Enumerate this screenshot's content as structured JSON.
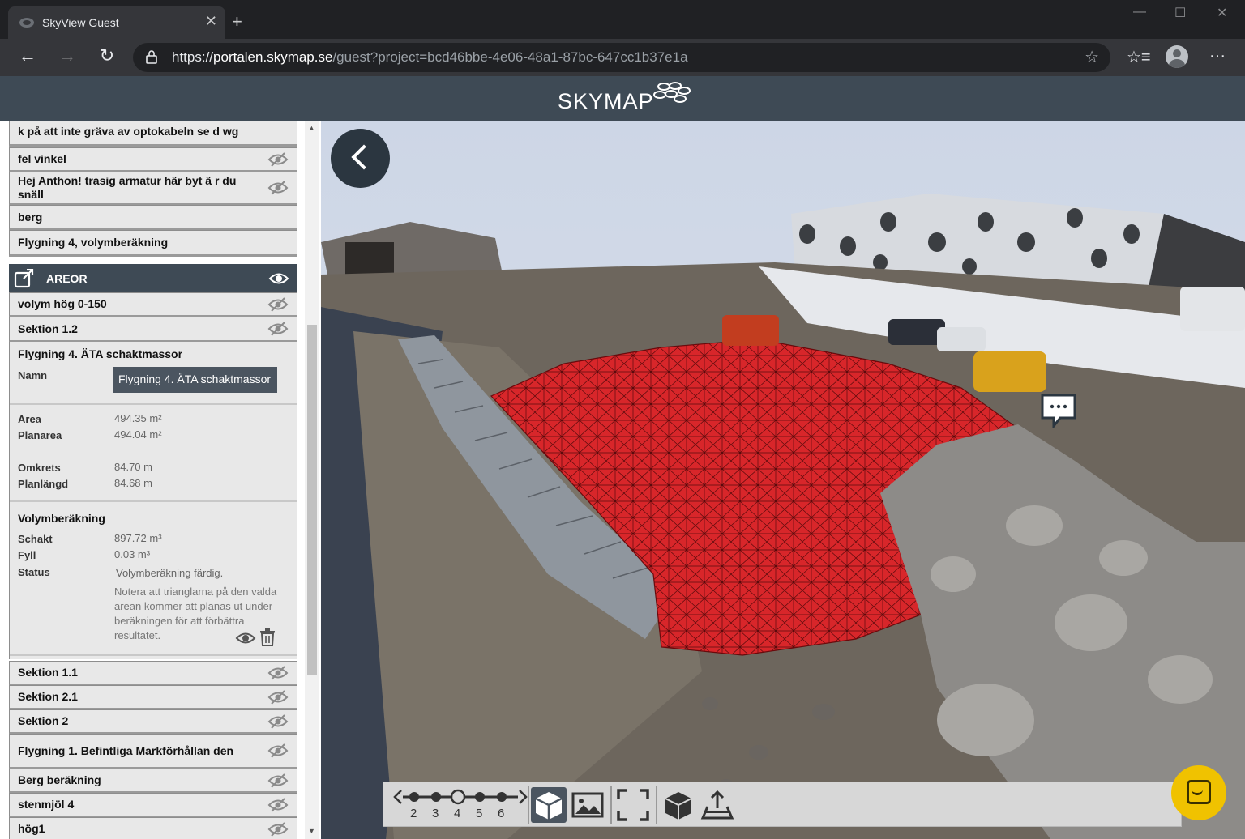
{
  "browser": {
    "tab_title": "SkyView Guest",
    "tab_close": "✕",
    "new_tab": "+",
    "url_scheme": "https://",
    "url_host": "portalen.skymap.se",
    "url_rest": "/guest?project=bcd46bbe-4e06-48a1-87bc-647cc1b37e1a",
    "back": "←",
    "forward": "→",
    "reload": "↻",
    "star": "☆",
    "favorites": "☆≡",
    "more": "···",
    "minimize": "—",
    "maximize": "☐",
    "close": "✕"
  },
  "header": {
    "logo": "SKYMAP"
  },
  "sidebar": {
    "top_rows": [
      "k på att inte gräva av optokabeln se d wg",
      "fel vinkel",
      "Hej Anthon! trasig armatur här byt ä r du snäll",
      "berg",
      "Flygning 4, volymberäkning"
    ],
    "section_title": "AREOR",
    "area_rows": [
      "volym hög 0-150",
      "Sektion 1.2"
    ],
    "detail": {
      "title": "Flygning 4. ÄTA schaktmassor",
      "name_label": "Namn",
      "name_value": "Flygning 4. ÄTA schaktmassor",
      "area_label": "Area",
      "area_value": "494.35 m²",
      "planarea_label": "Planarea",
      "planarea_value": "494.04 m²",
      "omkrets_label": "Omkrets",
      "omkrets_value": "84.70 m",
      "planlangd_label": "Planlängd",
      "planlangd_value": "84.68 m",
      "volume_title": "Volymberäkning",
      "schakt_label": "Schakt",
      "schakt_value": "897.72 m³",
      "fyll_label": "Fyll",
      "fyll_value": "0.03 m³",
      "status_label": "Status",
      "status_value": "Volymberäkning färdig.",
      "note": "Notera att trianglarna på den valda arean kommer att planas ut under beräkningen för att förbättra resultatet."
    },
    "bottom_rows": [
      "Sektion 1.1",
      "Sektion 2.1",
      "Sektion 2",
      "Flygning 1. Befintliga Markförhållan den",
      "Berg beräkning",
      "stenmjöl 4",
      "hög1"
    ]
  },
  "toolbar": {
    "timeline": [
      "2",
      "3",
      "4",
      "5",
      "6"
    ],
    "tools": [
      "3d-model-icon",
      "image-icon",
      "fullscreen-icon",
      "cube-icon",
      "export-icon"
    ]
  },
  "colors": {
    "header_bg": "#3e4a55",
    "selection_red": "#d8262a",
    "chat_yellow": "#f0c200"
  }
}
